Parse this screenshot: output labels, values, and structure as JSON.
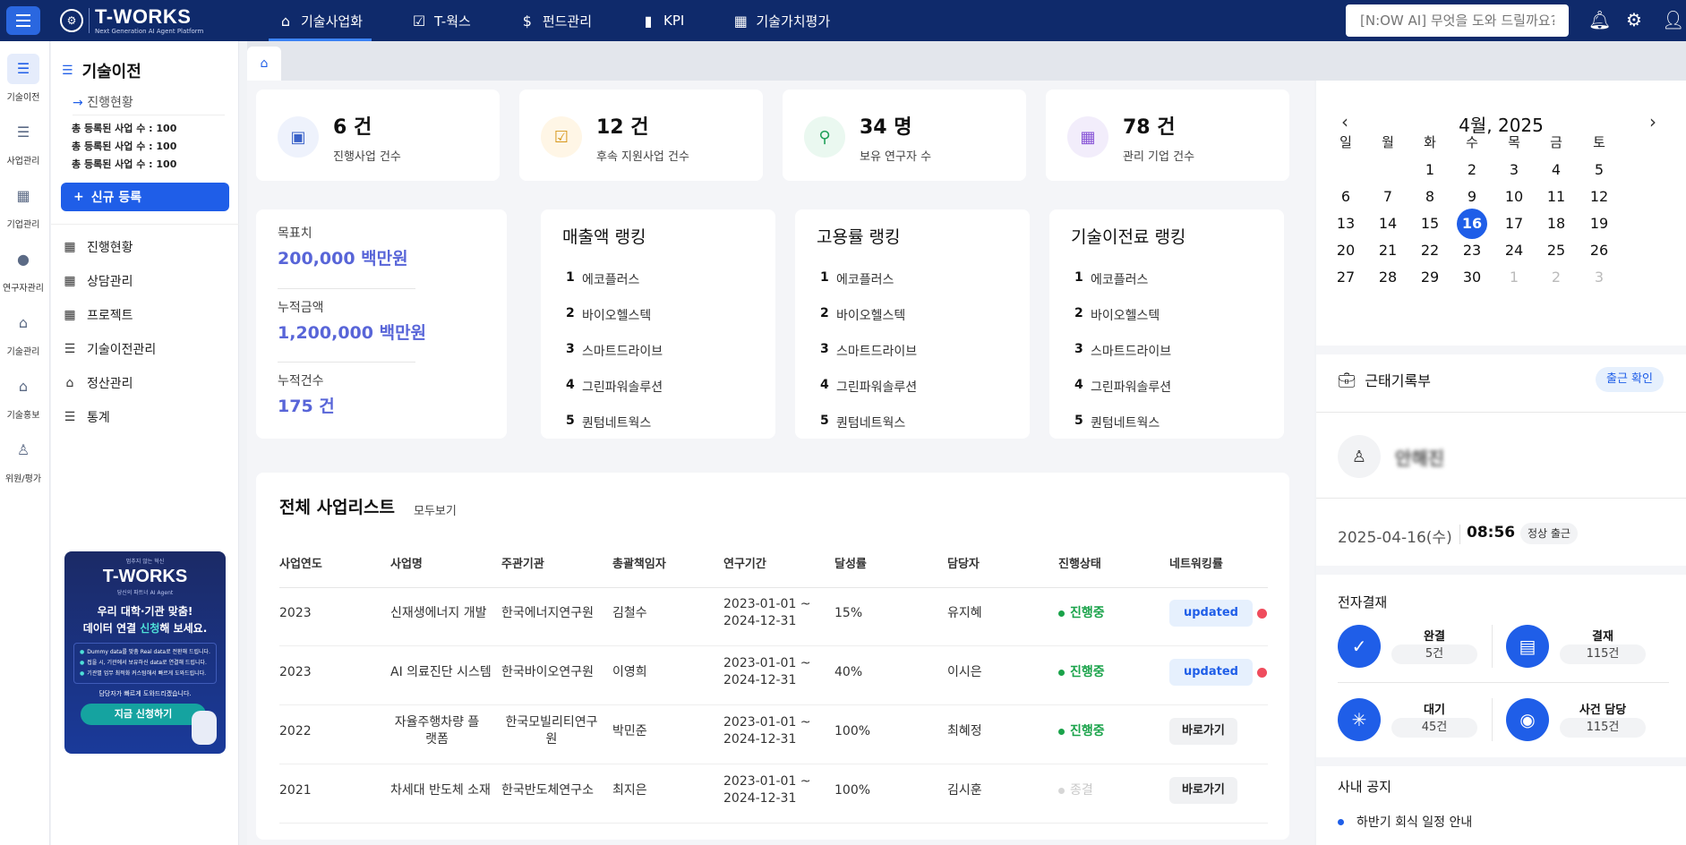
{
  "app": {
    "logo_title": "T-WORKS",
    "logo_sub": "Next Generation AI Agent Platform"
  },
  "topnav": [
    {
      "label": "기술사업화",
      "icon": "home-icon",
      "active": true
    },
    {
      "label": "T-웍스",
      "icon": "clipboard-check-icon"
    },
    {
      "label": "펀드관리",
      "icon": "dollar-icon"
    },
    {
      "label": "KPI",
      "icon": "bar-chart-icon"
    },
    {
      "label": "기술가치평가",
      "icon": "calculator-icon"
    }
  ],
  "search": {
    "placeholder": "[N:OW AI] 무엇을 도와 드릴까요?"
  },
  "rail": [
    {
      "label": "기술이전",
      "icon": "list-icon"
    },
    {
      "label": "사업관리",
      "icon": "list-icon"
    },
    {
      "label": "기업관리",
      "icon": "building-icon"
    },
    {
      "label": "연구자관리",
      "icon": "user-icon"
    },
    {
      "label": "기술관리",
      "icon": "box-icon"
    },
    {
      "label": "기술홍보",
      "icon": "box-icon"
    },
    {
      "label": "위원/평가",
      "icon": "person-icon"
    }
  ],
  "sidebar": {
    "title": "기술이전",
    "sub": "진행현황",
    "stats": [
      "총 등록된 사업 수 : 100",
      "총 등록된 사업 수 : 100",
      "총 등록된 사업 수 : 100"
    ],
    "new_button": "신규 등록",
    "menu": [
      {
        "label": "진행현황",
        "icon": "building-icon"
      },
      {
        "label": "상담관리",
        "icon": "building-icon"
      },
      {
        "label": "프로젝트",
        "icon": "building-icon"
      },
      {
        "label": "기술이전관리",
        "icon": "list-icon"
      },
      {
        "label": "정산관리",
        "icon": "box-icon"
      },
      {
        "label": "통계",
        "icon": "list-icon"
      }
    ],
    "banner": {
      "top": "멈추지 않는 혁신",
      "logo": "T-WORKS",
      "sub": "당신의 파트너 AI Agent",
      "headline1": "우리 대학·기관 맞춤!",
      "headline2_a": "데이터 연결 ",
      "headline2_b": "신청",
      "headline2_c": "해 보세요.",
      "bullets": [
        "Dummy data를 맞춤 Real data로 전환해 드립니다.",
        "접을 시, 기관에서 보유하신 data로 연결해 드립니다.",
        "기관별 업무 최적화 커스텀해서 빠르게 도와드립니다."
      ],
      "note": "담당자가 빠르게 도와드리겠습니다.",
      "button": "지금 신청하기"
    }
  },
  "kpis": [
    {
      "value": "6 건",
      "label": "진행사업 건수",
      "icon": "bookmark-icon",
      "bg": "#eef2fc",
      "fg": "#3a62c9"
    },
    {
      "value": "12 건",
      "label": "후속 지원사업 건수",
      "icon": "checklist-icon",
      "bg": "#fff6e6",
      "fg": "#d6971b"
    },
    {
      "value": "34 명",
      "label": "보유 연구자 수",
      "icon": "user-search-icon",
      "bg": "#eaf8f0",
      "fg": "#21a05a"
    },
    {
      "value": "78 건",
      "label": "관리 기업 건수",
      "icon": "building-icon",
      "bg": "#f2edfb",
      "fg": "#8753d6"
    }
  ],
  "goals": [
    {
      "label": "목표치",
      "value": "200,000 백만원"
    },
    {
      "label": "누적금액",
      "value": "1,200,000 백만원"
    },
    {
      "label": "누적건수",
      "value": "175 건"
    }
  ],
  "rankings": [
    {
      "title": "매출액 랭킹",
      "items": [
        "에코플러스",
        "바이오헬스텍",
        "스마트드라이브",
        "그린파워솔루션",
        "퀀텀네트웍스"
      ]
    },
    {
      "title": "고용률 랭킹",
      "items": [
        "에코플러스",
        "바이오헬스텍",
        "스마트드라이브",
        "그린파워솔루션",
        "퀀텀네트웍스"
      ]
    },
    {
      "title": "기술이전료 랭킹",
      "items": [
        "에코플러스",
        "바이오헬스텍",
        "스마트드라이브",
        "그린파워솔루션",
        "퀀텀네트웍스"
      ]
    }
  ],
  "ranking_numbers": [
    "1",
    "2",
    "3",
    "4",
    "5"
  ],
  "projects": {
    "title": "전체 사업리스트",
    "more": "모두보기",
    "headers": [
      "사업연도",
      "사업명",
      "주관기관",
      "총괄책임자",
      "연구기간",
      "달성률",
      "담당자",
      "진행상태",
      "네트워킹률"
    ],
    "rows": [
      {
        "year": "2023",
        "name": "신재생에너지 개발",
        "org": "한국에너지연구원",
        "lead": "김철수",
        "period1": "2023-01-01 ~",
        "period2": "2024-12-31",
        "rate": "15%",
        "manager": "유지혜",
        "status": "진행중",
        "action": "updated",
        "alert": true
      },
      {
        "year": "2023",
        "name": "AI 의료진단 시스템",
        "org": "한국바이오연구원",
        "lead": "이영희",
        "period1": "2023-01-01 ~",
        "period2": "2024-12-31",
        "rate": "40%",
        "manager": "이시은",
        "status": "진행중",
        "action": "updated",
        "alert": true
      },
      {
        "year": "2022",
        "name": "자율주행차량 플랫폼",
        "org": "한국모빌리티연구원",
        "lead": "박민준",
        "period1": "2023-01-01 ~",
        "period2": "2024-12-31",
        "rate": "100%",
        "manager": "최혜정",
        "status": "진행중",
        "action": "바로가기",
        "alert": false
      },
      {
        "year": "2021",
        "name": "차세대 반도체 소재",
        "org": "한국반도체연구소",
        "lead": "최지은",
        "period1": "2023-01-01 ~",
        "period2": "2024-12-31",
        "rate": "100%",
        "manager": "김시훈",
        "status": "종결",
        "action": "바로가기",
        "alert": false
      }
    ],
    "status_colors": {
      "진행중": "#1aa34a",
      "종결": "#c8c8c8"
    }
  },
  "calendar": {
    "title": "4월, 2025",
    "weekdays": [
      "일",
      "월",
      "화",
      "수",
      "목",
      "금",
      "토"
    ],
    "days": [
      [
        "",
        "",
        "1",
        "2",
        "3",
        "4",
        "5"
      ],
      [
        "6",
        "7",
        "8",
        "9",
        "10",
        "11",
        "12"
      ],
      [
        "13",
        "14",
        "15",
        "16",
        "17",
        "18",
        "19"
      ],
      [
        "20",
        "21",
        "22",
        "23",
        "24",
        "25",
        "26"
      ],
      [
        "27",
        "28",
        "29",
        "30",
        "1",
        "2",
        "3"
      ]
    ],
    "today": "16"
  },
  "attendance": {
    "title": "근태기록부",
    "button": "출근 확인",
    "user": "안해진",
    "date": "2025-04-16(수)",
    "time": "08:56",
    "state": "정상 출근"
  },
  "approval": {
    "title": "전자결재",
    "items": [
      {
        "label": "완결",
        "count": "5건",
        "icon": "check-icon"
      },
      {
        "label": "결재",
        "count": "115건",
        "icon": "document-icon"
      },
      {
        "label": "대기",
        "count": "45건",
        "icon": "spinner-icon"
      },
      {
        "label": "사건 담당",
        "count": "115건",
        "icon": "user-circle-icon"
      }
    ]
  },
  "notice": {
    "title": "사내 공지",
    "items": [
      "하반기 회식 일정 안내"
    ]
  },
  "colors": {
    "primary": "#1f5ee8",
    "navy": "#0f2a6b",
    "goal": "#5865d8",
    "alert": "#ef4c5d"
  }
}
